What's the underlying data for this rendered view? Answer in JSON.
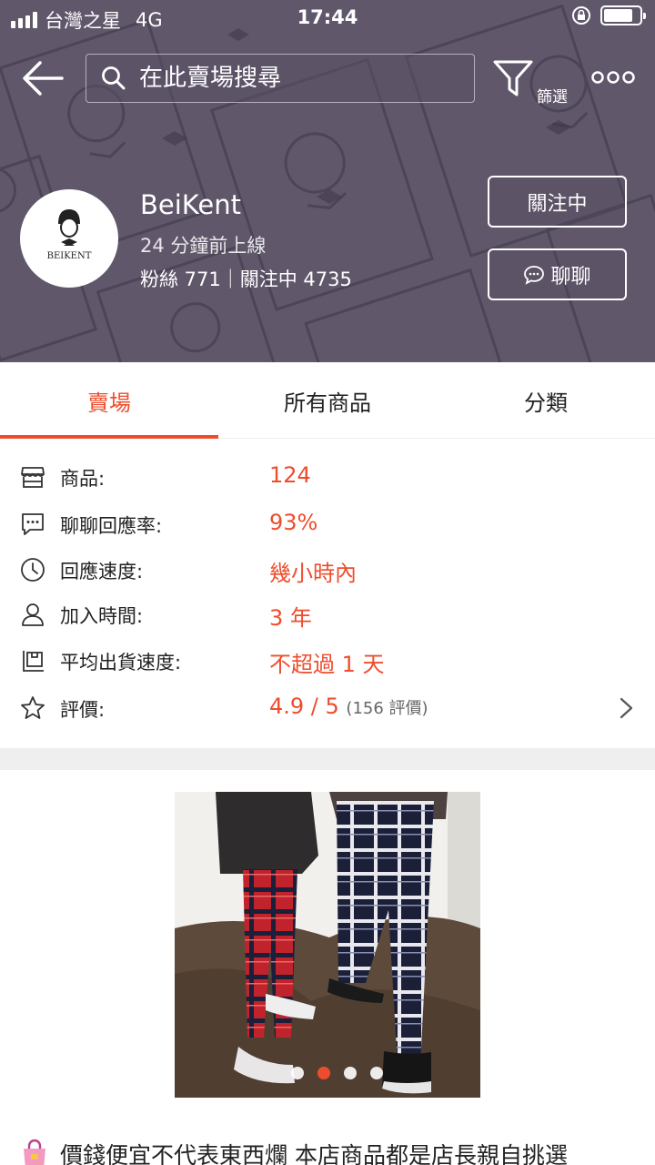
{
  "status_bar": {
    "carrier": "台灣之星",
    "network": "4G",
    "time": "17:44"
  },
  "search": {
    "placeholder": "在此賣場搜尋"
  },
  "toolbar": {
    "filter_label": "篩選"
  },
  "shop": {
    "name": "BeiKent",
    "avatar_text": "BEIKENT",
    "last_online": "24 分鐘前上線",
    "followers_text": "粉絲 771｜關注中 4735",
    "follow_button": "關注中",
    "chat_button": "聊聊"
  },
  "tabs": [
    {
      "label": "賣場",
      "active": true
    },
    {
      "label": "所有商品",
      "active": false
    },
    {
      "label": "分類",
      "active": false
    }
  ],
  "stats": {
    "products": {
      "label": "商品:",
      "value": "124"
    },
    "chat_rate": {
      "label": "聊聊回應率:",
      "value": "93%"
    },
    "response_speed": {
      "label": "回應速度:",
      "value": "幾小時內"
    },
    "joined": {
      "label": "加入時間:",
      "value": "3 年"
    },
    "shipping_speed": {
      "label": "平均出貨速度:",
      "value": "不超過 1 天"
    },
    "rating": {
      "label": "評價:",
      "value": "4.9 / 5",
      "count": "(156 評價)"
    }
  },
  "banner": {
    "slide_count": 4,
    "active_slide": 1
  },
  "description": {
    "text": "價錢便宜不代表東西爛 本店商品都是店長親自挑選"
  },
  "colors": {
    "accent": "#ee4d2d",
    "header_bg": "#6f6678"
  }
}
